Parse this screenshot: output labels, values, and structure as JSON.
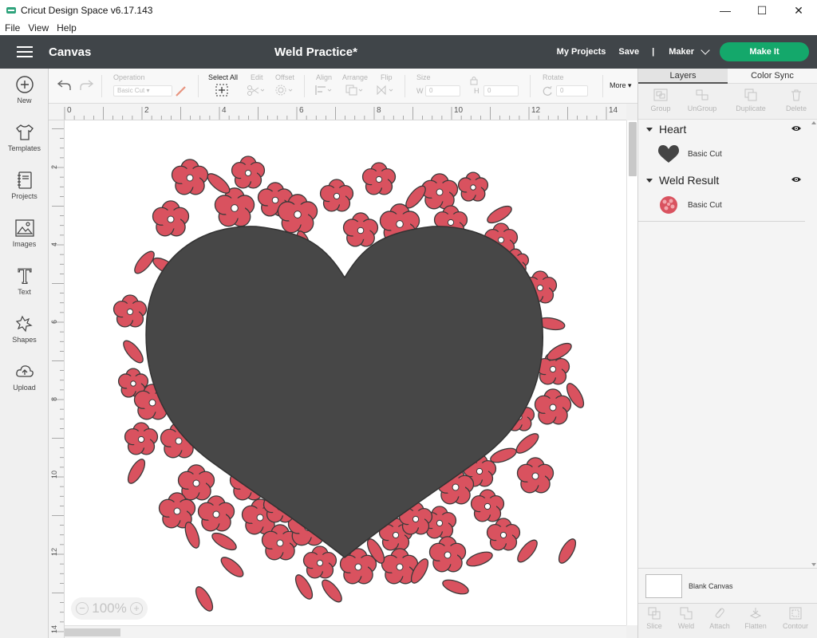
{
  "window": {
    "title": "Cricut Design Space  v6.17.143",
    "controls": [
      "—",
      "☐",
      "✕"
    ]
  },
  "menu": [
    "File",
    "View",
    "Help"
  ],
  "header": {
    "section": "Canvas",
    "project_title": "Weld Practice*",
    "my_projects": "My Projects",
    "save": "Save",
    "separator": "|",
    "machine": "Maker",
    "make_it": "Make It",
    "make_it_color": "#14a86b",
    "bar_color": "#404549"
  },
  "sidebar": [
    {
      "label": "New",
      "icon": "plus-circle-icon"
    },
    {
      "label": "Templates",
      "icon": "tshirt-icon"
    },
    {
      "label": "Projects",
      "icon": "notebook-icon"
    },
    {
      "label": "Images",
      "icon": "image-icon"
    },
    {
      "label": "Text",
      "icon": "text-t-icon"
    },
    {
      "label": "Shapes",
      "icon": "shapes-icon"
    },
    {
      "label": "Upload",
      "icon": "upload-cloud-icon"
    }
  ],
  "toolbar": {
    "operation_label": "Operation",
    "operation_value": "Basic Cut",
    "select_all": "Select All",
    "edit": "Edit",
    "offset": "Offset",
    "align": "Align",
    "arrange": "Arrange",
    "flip": "Flip",
    "size": "Size",
    "w_label": "W",
    "h_label": "H",
    "w_value": "0",
    "h_value": "0",
    "rotate": "Rotate",
    "rotate_value": "0",
    "more": "More"
  },
  "ruler": {
    "top": [
      "0",
      "2",
      "4",
      "6",
      "8",
      "10",
      "12",
      "14"
    ],
    "left": [
      "2",
      "4",
      "6",
      "8",
      "10",
      "12",
      "14"
    ]
  },
  "canvas": {
    "zoom": "100%",
    "zoom_minus": "−",
    "zoom_plus": "+",
    "heart_color": "#474747",
    "flower_color": "#d9525f"
  },
  "right_panel": {
    "tabs": [
      "Layers",
      "Color Sync"
    ],
    "actions": [
      "Group",
      "UnGroup",
      "Duplicate",
      "Delete"
    ],
    "layers": [
      {
        "group": "Heart",
        "item": "Basic Cut"
      },
      {
        "group": "Weld Result",
        "item": "Basic Cut"
      }
    ],
    "blank_canvas": "Blank Canvas",
    "bottom_actions": [
      "Slice",
      "Weld",
      "Attach",
      "Flatten",
      "Contour"
    ]
  }
}
